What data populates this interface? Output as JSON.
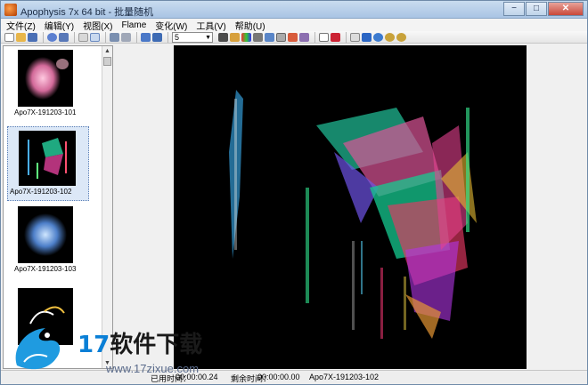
{
  "window": {
    "title": "Apophysis 7x 64 bit - 批量随机",
    "minimize_glyph": "−",
    "maximize_glyph": "□",
    "close_glyph": "✕"
  },
  "menu": [
    "文件(Z)",
    "编辑(Y)",
    "视图(X)",
    "Flame",
    "变化(W)",
    "工具(V)",
    "帮助(U)"
  ],
  "toolbar": {
    "density_value": "5",
    "dropdown_arrow": "▼"
  },
  "thumbnails": [
    {
      "label": "Apo7X-191203-101",
      "selected": false
    },
    {
      "label": "Apo7X-191203-102",
      "selected": true
    },
    {
      "label": "Apo7X-191203-103",
      "selected": false
    },
    {
      "label": "",
      "selected": false
    }
  ],
  "scroll": {
    "up_glyph": "▲",
    "down_glyph": "▼"
  },
  "status": {
    "elapsed_label": "已用时间：",
    "elapsed_value": "00:00:00.24",
    "remaining_label": "剩余时间：",
    "remaining_value": "00:00:00.00",
    "flame_name": "Apo7X-191203-102"
  },
  "watermark": {
    "number": "17",
    "text": "软件下载",
    "url": "www.17zixue.com"
  },
  "colors": {
    "canvas_bg": "#000000",
    "selection": "#dce8f7"
  }
}
